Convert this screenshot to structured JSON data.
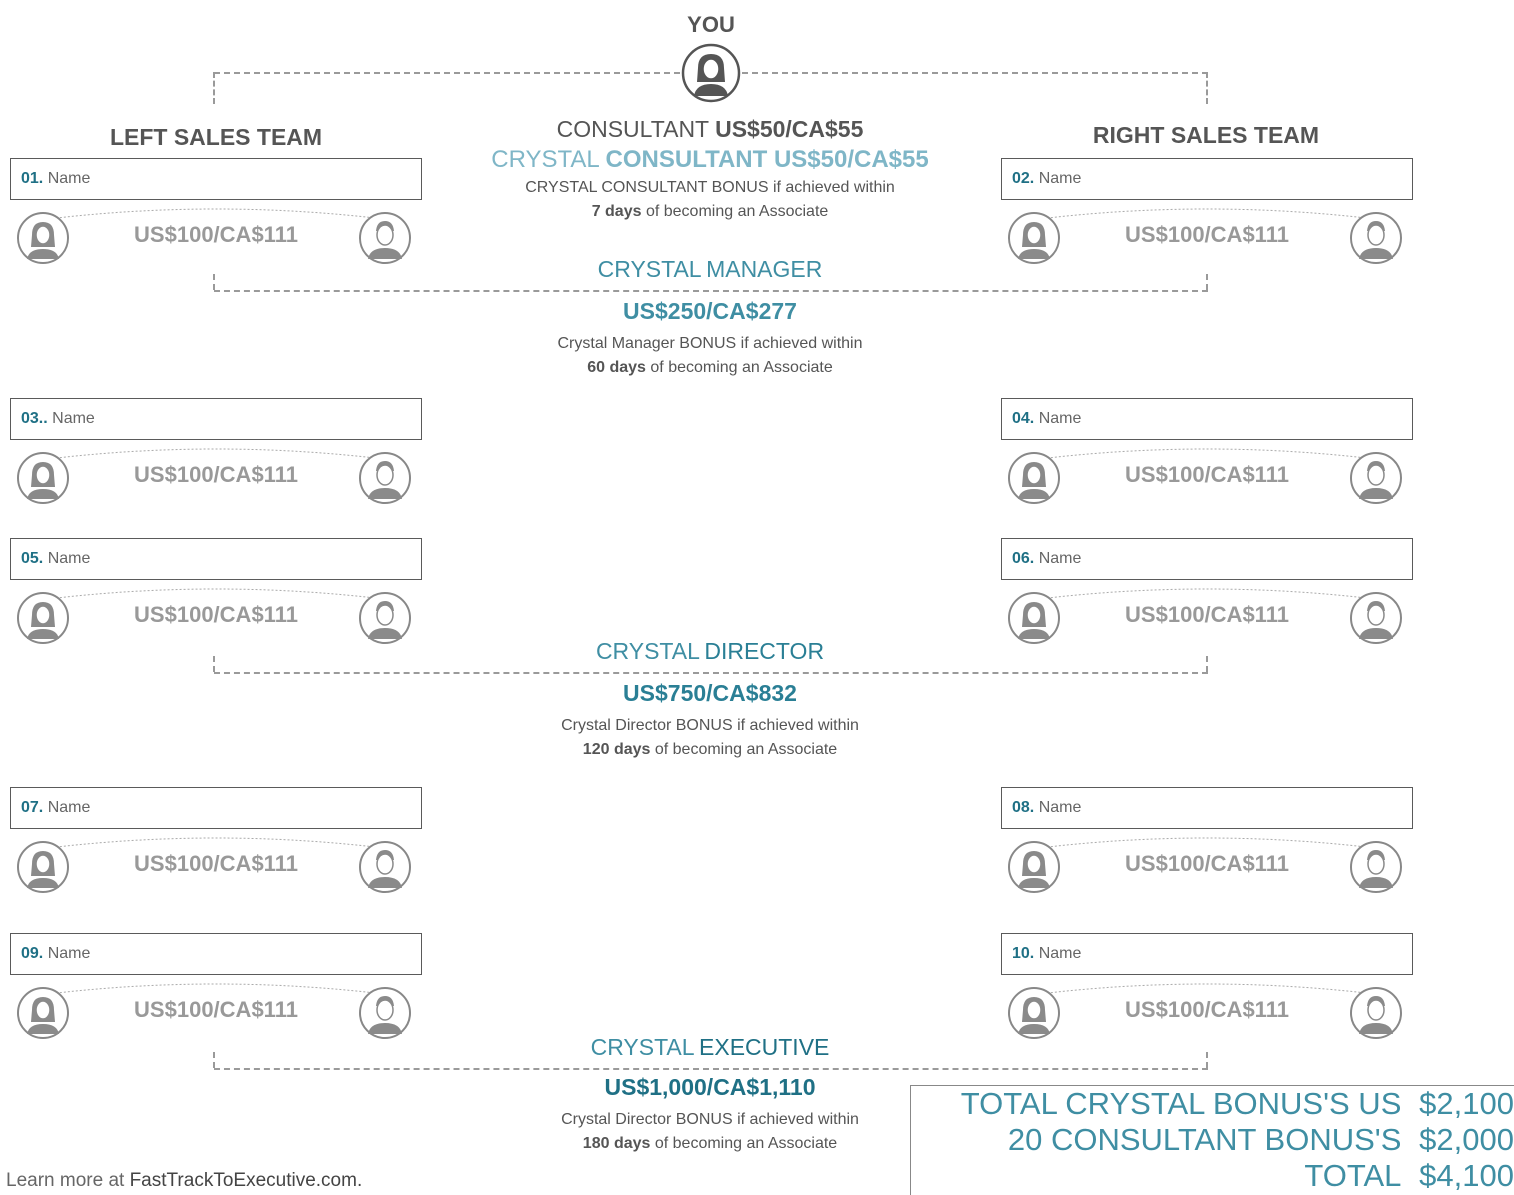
{
  "you_label": "YOU",
  "left_team_title": "LEFT SALES TEAM",
  "right_team_title": "RIGHT SALES TEAM",
  "consultant": {
    "label": "CONSULTANT",
    "amount": "US$50/CA$55"
  },
  "crystal_consultant": {
    "prefix": "CRYSTAL",
    "rank": "CONSULTANT",
    "amount": "US$50/CA$55",
    "desc_line1": "CRYSTAL CONSULTANT BONUS if achieved within",
    "desc_days": "7 days",
    "desc_rest": "of becoming an Associate"
  },
  "crystal_manager": {
    "prefix": "CRYSTAL",
    "rank": "MANAGER",
    "amount": "US$250/CA$277",
    "desc_line1": "Crystal Manager BONUS if achieved within",
    "desc_days": "60 days",
    "desc_rest": "of becoming an Associate"
  },
  "crystal_director": {
    "prefix": "CRYSTAL",
    "rank": "DIRECTOR",
    "amount": "US$750/CA$832",
    "desc_line1": "Crystal Director BONUS if achieved within",
    "desc_days": "120 days",
    "desc_rest": "of becoming an Associate"
  },
  "crystal_executive": {
    "prefix": "CRYSTAL",
    "rank": "EXECUTIVE",
    "amount": "US$1,000/CA$1,110",
    "desc_line1": "Crystal Director BONUS if achieved within",
    "desc_days": "180 days",
    "desc_rest": "of becoming an Associate"
  },
  "members": [
    {
      "num": "01.",
      "name": "Name",
      "amount": "US$100/CA$111"
    },
    {
      "num": "02.",
      "name": "Name",
      "amount": "US$100/CA$111"
    },
    {
      "num": "03..",
      "name": "Name",
      "amount": "US$100/CA$111"
    },
    {
      "num": "04.",
      "name": "Name",
      "amount": "US$100/CA$111"
    },
    {
      "num": "05.",
      "name": "Name",
      "amount": "US$100/CA$111"
    },
    {
      "num": "06.",
      "name": "Name",
      "amount": "US$100/CA$111"
    },
    {
      "num": "07.",
      "name": "Name",
      "amount": "US$100/CA$111"
    },
    {
      "num": "08.",
      "name": "Name",
      "amount": "US$100/CA$111"
    },
    {
      "num": "09.",
      "name": "Name",
      "amount": "US$100/CA$111"
    },
    {
      "num": "10.",
      "name": "Name",
      "amount": "US$100/CA$111"
    }
  ],
  "totals": [
    {
      "label": "TOTAL CRYSTAL BONUS'S US",
      "value": "$2,100"
    },
    {
      "label": "20 CONSULTANT BONUS'S",
      "value": "$2,000"
    },
    {
      "label": "TOTAL",
      "value": "$4,100"
    }
  ],
  "footer": {
    "prefix": "Learn more at",
    "link": "FastTrackToExecutive.com."
  },
  "colors": {
    "teal_light": "#7fb6c7",
    "teal": "#3f8ea3",
    "teal_dark": "#1f7085",
    "gray_text": "#555555",
    "amount_gray": "#999999"
  }
}
